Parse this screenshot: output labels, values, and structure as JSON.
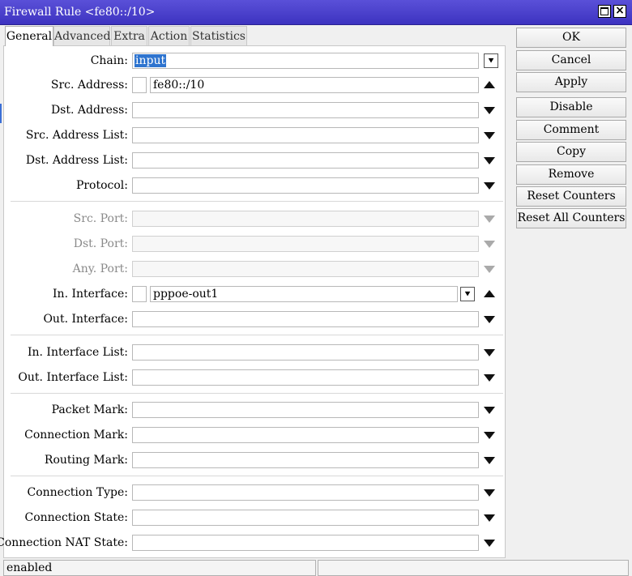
{
  "window": {
    "title": "Firewall Rule <fe80::/10>"
  },
  "tabs": [
    {
      "label": "General",
      "active": true
    },
    {
      "label": "Advanced",
      "active": false
    },
    {
      "label": "Extra",
      "active": false
    },
    {
      "label": "Action",
      "active": false
    },
    {
      "label": "Statistics",
      "active": false
    }
  ],
  "fields": {
    "chain": {
      "label": "Chain:",
      "value": "input"
    },
    "src_address": {
      "label": "Src. Address:",
      "value": "fe80::/10"
    },
    "dst_address": {
      "label": "Dst. Address:",
      "value": ""
    },
    "src_address_list": {
      "label": "Src. Address List:",
      "value": ""
    },
    "dst_address_list": {
      "label": "Dst. Address List:",
      "value": ""
    },
    "protocol": {
      "label": "Protocol:",
      "value": ""
    },
    "src_port": {
      "label": "Src. Port:",
      "value": ""
    },
    "dst_port": {
      "label": "Dst. Port:",
      "value": ""
    },
    "any_port": {
      "label": "Any. Port:",
      "value": ""
    },
    "in_interface": {
      "label": "In. Interface:",
      "value": "pppoe-out1"
    },
    "out_interface": {
      "label": "Out. Interface:",
      "value": ""
    },
    "in_interface_list": {
      "label": "In. Interface List:",
      "value": ""
    },
    "out_interface_list": {
      "label": "Out. Interface List:",
      "value": ""
    },
    "packet_mark": {
      "label": "Packet Mark:",
      "value": ""
    },
    "connection_mark": {
      "label": "Connection Mark:",
      "value": ""
    },
    "routing_mark": {
      "label": "Routing Mark:",
      "value": ""
    },
    "connection_type": {
      "label": "Connection Type:",
      "value": ""
    },
    "connection_state": {
      "label": "Connection State:",
      "value": ""
    },
    "connection_nat_state": {
      "label": "Connection NAT State:",
      "value": ""
    }
  },
  "buttons": {
    "ok": "OK",
    "cancel": "Cancel",
    "apply": "Apply",
    "disable": "Disable",
    "comment": "Comment",
    "copy": "Copy",
    "remove": "Remove",
    "reset_counters": "Reset Counters",
    "reset_all_counters": "Reset All Counters"
  },
  "status": {
    "text": "enabled"
  },
  "icons": {
    "dropdown": "dropdown-icon",
    "expand": "triangle-down-icon",
    "collapse": "triangle-up-icon"
  },
  "colors": {
    "titlebar": "#4a40cf",
    "selection": "#2e74cf"
  }
}
